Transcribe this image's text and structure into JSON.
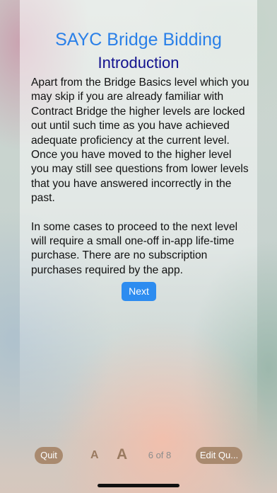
{
  "header": {
    "app_title": "SAYC Bridge Bidding",
    "page_title": "Introduction"
  },
  "content": {
    "paragraphs": [
      "Apart from the Bridge Basics level which you may skip if you are already familiar with Contract Bridge the higher levels are locked out until such time as you have achieved adequate proficiency at the current level. Once you have moved to the higher level you may still see questions from lower levels that you have answered incorrectly in the past.",
      "In some cases to proceed to the next level will require a small one-off in-app life-time purchase. There are no subscription purchases required by the app."
    ],
    "next_label": "Next"
  },
  "toolbar": {
    "quit_label": "Quit",
    "font_small_label": "A",
    "font_large_label": "A",
    "page_counter": "6 of 8",
    "edit_label": "Edit Qu..."
  },
  "colors": {
    "title_blue": "#2a80e8",
    "subtitle_navy": "#12128e",
    "button_blue": "#2d8cf0",
    "pill_brown": "#a98a6f",
    "font_toggle_brown": "#9a7a60"
  }
}
